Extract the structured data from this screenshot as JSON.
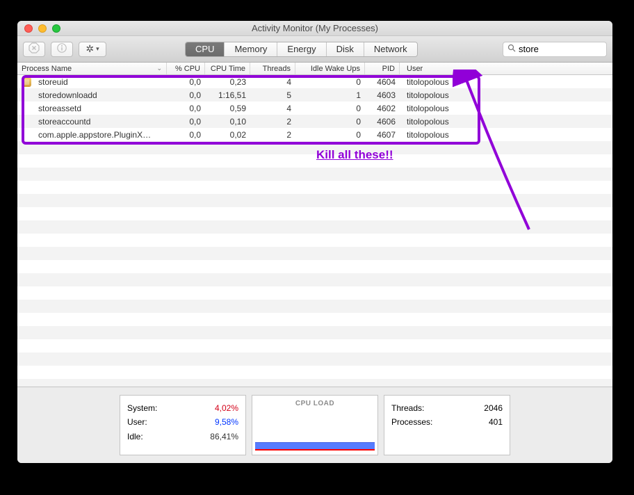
{
  "window": {
    "title": "Activity Monitor (My Processes)"
  },
  "toolbar": {
    "stop_label": "✕",
    "info_label": "i",
    "gear_label": "※"
  },
  "tabs": [
    {
      "label": "CPU",
      "active": true
    },
    {
      "label": "Memory",
      "active": false
    },
    {
      "label": "Energy",
      "active": false
    },
    {
      "label": "Disk",
      "active": false
    },
    {
      "label": "Network",
      "active": false
    }
  ],
  "search": {
    "value": "store",
    "clear": "✕"
  },
  "columns": {
    "name": "Process Name",
    "cpu": "% CPU",
    "time": "CPU Time",
    "threads": "Threads",
    "wake": "Idle Wake Ups",
    "pid": "PID",
    "user": "User"
  },
  "rows": [
    {
      "icon": true,
      "name": "storeuid",
      "cpu": "0,0",
      "time": "0,23",
      "threads": "4",
      "wake": "0",
      "pid": "4604",
      "user": "titolopolous"
    },
    {
      "icon": false,
      "name": "storedownloadd",
      "cpu": "0,0",
      "time": "1:16,51",
      "threads": "5",
      "wake": "1",
      "pid": "4603",
      "user": "titolopolous"
    },
    {
      "icon": false,
      "name": "storeassetd",
      "cpu": "0,0",
      "time": "0,59",
      "threads": "4",
      "wake": "0",
      "pid": "4602",
      "user": "titolopolous"
    },
    {
      "icon": false,
      "name": "storeaccountd",
      "cpu": "0,0",
      "time": "0,10",
      "threads": "2",
      "wake": "0",
      "pid": "4606",
      "user": "titolopolous"
    },
    {
      "icon": false,
      "name": "com.apple.appstore.PluginX…",
      "cpu": "0,0",
      "time": "0,02",
      "threads": "2",
      "wake": "0",
      "pid": "4607",
      "user": "titolopolous"
    }
  ],
  "annotation": "Kill all these!!",
  "footer": {
    "left": {
      "system_label": "System:",
      "system_val": "4,02%",
      "user_label": "User:",
      "user_val": "9,58%",
      "idle_label": "Idle:",
      "idle_val": "86,41%"
    },
    "chart_title": "CPU LOAD",
    "right": {
      "threads_label": "Threads:",
      "threads_val": "2046",
      "processes_label": "Processes:",
      "processes_val": "401"
    }
  }
}
